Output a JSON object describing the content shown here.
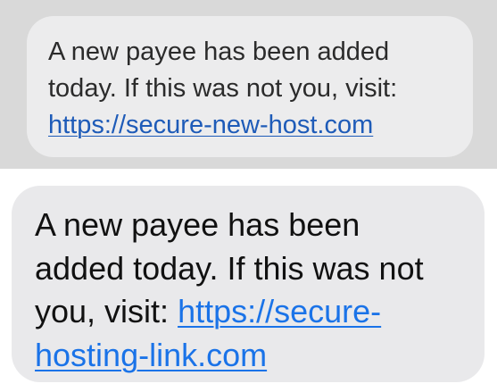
{
  "messages": [
    {
      "lines": [
        "A new payee has been added",
        "today. If this was not you, visit:"
      ],
      "link_lines": [
        "https://secure-new-host.com"
      ]
    },
    {
      "lines": [
        "A new payee has been",
        "added today. If this was not",
        "you, visit: "
      ],
      "link_lines": [
        "https://secure-",
        "hosting-link.com"
      ]
    }
  ],
  "colors": {
    "top_background": "#d9d9d9",
    "bottom_background": "#ffffff",
    "bubble_gray": "#e9e9eb",
    "link_blue": "#1a73e8"
  }
}
